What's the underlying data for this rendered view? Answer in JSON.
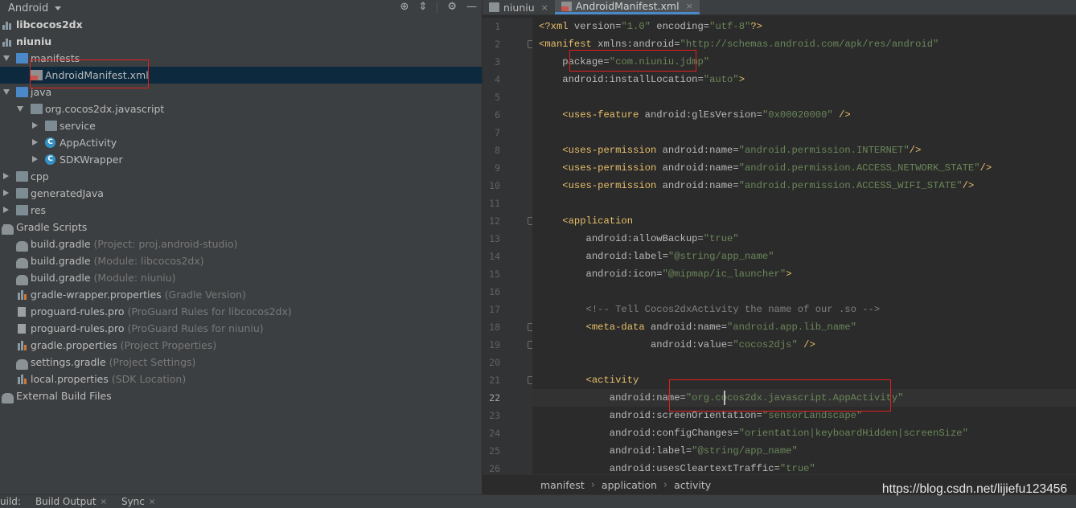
{
  "project_panel": {
    "view_mode": "Android",
    "tools": [
      "locate-icon",
      "collapse-icon",
      "gear-icon",
      "hide-icon"
    ],
    "tree": [
      {
        "label": "libcocos2dx",
        "bold": true
      },
      {
        "label": "niuniu",
        "bold": true
      },
      {
        "label": "manifests"
      },
      {
        "label": "AndroidManifest.xml",
        "selected": true
      },
      {
        "label": "java"
      },
      {
        "label": "org.cocos2dx.javascript"
      },
      {
        "label": "service"
      },
      {
        "label": "AppActivity"
      },
      {
        "label": "SDKWrapper"
      },
      {
        "label": "cpp"
      },
      {
        "label": "generatedJava"
      },
      {
        "label": "res"
      },
      {
        "label": "Gradle Scripts"
      },
      {
        "label": "build.gradle",
        "hint": "(Project: proj.android-studio)"
      },
      {
        "label": "build.gradle",
        "hint": "(Module: libcocos2dx)"
      },
      {
        "label": "build.gradle",
        "hint": "(Module: niuniu)"
      },
      {
        "label": "gradle-wrapper.properties",
        "hint": "(Gradle Version)"
      },
      {
        "label": "proguard-rules.pro",
        "hint": "(ProGuard Rules for libcocos2dx)"
      },
      {
        "label": "proguard-rules.pro",
        "hint": "(ProGuard Rules for niuniu)"
      },
      {
        "label": "gradle.properties",
        "hint": "(Project Properties)"
      },
      {
        "label": "settings.gradle",
        "hint": "(Project Settings)"
      },
      {
        "label": "local.properties",
        "hint": "(SDK Location)"
      },
      {
        "label": "External Build Files"
      }
    ]
  },
  "editor": {
    "tabs": [
      {
        "label": "niuniu",
        "close": "×"
      },
      {
        "label": "AndroidManifest.xml",
        "close": "×",
        "active": true
      }
    ],
    "current_line": 22,
    "lines": [
      {
        "n": 1,
        "tokens": [
          [
            "t",
            "<?xml "
          ],
          [
            "a",
            "version="
          ],
          [
            "s",
            "\"1.0\" "
          ],
          [
            "a",
            "encoding="
          ],
          [
            "s",
            "\"utf-8\""
          ],
          [
            "t",
            "?>"
          ]
        ]
      },
      {
        "n": 2,
        "tokens": [
          [
            "t",
            "<manifest "
          ],
          [
            "a",
            "xmlns:android="
          ],
          [
            "s",
            "\"http://schemas.android.com/apk/res/android\""
          ]
        ]
      },
      {
        "n": 3,
        "tokens": [
          [
            "a",
            "    package="
          ],
          [
            "s",
            "\"com.niuniu.jdmp\""
          ]
        ]
      },
      {
        "n": 4,
        "tokens": [
          [
            "a",
            "    android:installLocation="
          ],
          [
            "s",
            "\"auto\""
          ],
          [
            "t",
            ">"
          ]
        ]
      },
      {
        "n": 5,
        "tokens": []
      },
      {
        "n": 6,
        "tokens": [
          [
            "t",
            "    <uses-feature "
          ],
          [
            "a",
            "android:glEsVersion="
          ],
          [
            "s",
            "\"0x00020000\" "
          ],
          [
            "t",
            "/>"
          ]
        ]
      },
      {
        "n": 7,
        "tokens": []
      },
      {
        "n": 8,
        "tokens": [
          [
            "t",
            "    <uses-permission "
          ],
          [
            "a",
            "android:name="
          ],
          [
            "s",
            "\"android.permission.INTERNET\""
          ],
          [
            "t",
            "/>"
          ]
        ]
      },
      {
        "n": 9,
        "tokens": [
          [
            "t",
            "    <uses-permission "
          ],
          [
            "a",
            "android:name="
          ],
          [
            "s",
            "\"android.permission.ACCESS_NETWORK_STATE\""
          ],
          [
            "t",
            "/>"
          ]
        ]
      },
      {
        "n": 10,
        "tokens": [
          [
            "t",
            "    <uses-permission "
          ],
          [
            "a",
            "android:name="
          ],
          [
            "s",
            "\"android.permission.ACCESS_WIFI_STATE\""
          ],
          [
            "t",
            "/>"
          ]
        ]
      },
      {
        "n": 11,
        "tokens": []
      },
      {
        "n": 12,
        "tokens": [
          [
            "t",
            "    <application"
          ]
        ]
      },
      {
        "n": 13,
        "tokens": [
          [
            "a",
            "        android:allowBackup="
          ],
          [
            "s",
            "\"true\""
          ]
        ]
      },
      {
        "n": 14,
        "tokens": [
          [
            "a",
            "        android:label="
          ],
          [
            "s",
            "\"@string/app_name\""
          ]
        ]
      },
      {
        "n": 15,
        "tokens": [
          [
            "a",
            "        android:icon="
          ],
          [
            "s",
            "\"@mipmap/ic_launcher\""
          ],
          [
            "t",
            ">"
          ]
        ]
      },
      {
        "n": 16,
        "tokens": []
      },
      {
        "n": 17,
        "tokens": [
          [
            "cm",
            "        <!-- Tell Cocos2dxActivity the name of our .so -->"
          ]
        ]
      },
      {
        "n": 18,
        "tokens": [
          [
            "t",
            "        <meta-data "
          ],
          [
            "a",
            "android:name="
          ],
          [
            "s",
            "\"android.app.lib_name\""
          ]
        ]
      },
      {
        "n": 19,
        "tokens": [
          [
            "a",
            "                   android:value="
          ],
          [
            "s",
            "\"cocos2djs\" "
          ],
          [
            "t",
            "/>"
          ]
        ]
      },
      {
        "n": 20,
        "tokens": []
      },
      {
        "n": 21,
        "tokens": [
          [
            "t",
            "        <activity"
          ]
        ]
      },
      {
        "n": 22,
        "tokens": [
          [
            "a",
            "            android:name="
          ],
          [
            "s",
            "\"org.cocos2dx.javascript.AppActivity\""
          ]
        ]
      },
      {
        "n": 23,
        "tokens": [
          [
            "a",
            "            android:screenOrientation="
          ],
          [
            "s",
            "\"sensorLandscape\""
          ]
        ]
      },
      {
        "n": 24,
        "tokens": [
          [
            "a",
            "            android:configChanges="
          ],
          [
            "s",
            "\"orientation|keyboardHidden|screenSize\""
          ]
        ]
      },
      {
        "n": 25,
        "tokens": [
          [
            "a",
            "            android:label="
          ],
          [
            "s",
            "\"@string/app_name\""
          ]
        ]
      },
      {
        "n": 26,
        "tokens": [
          [
            "a",
            "            android:usesCleartextTraffic="
          ],
          [
            "s",
            "\"true\""
          ]
        ]
      }
    ],
    "breadcrumbs": [
      "manifest",
      "application",
      "activity"
    ]
  },
  "bottom_bar": {
    "prefix": "uild:",
    "tabs": [
      {
        "label": "Build Output",
        "close": "×"
      },
      {
        "label": "Sync",
        "close": "×"
      }
    ]
  },
  "watermark": "https://blog.csdn.net/lijiefu123456"
}
